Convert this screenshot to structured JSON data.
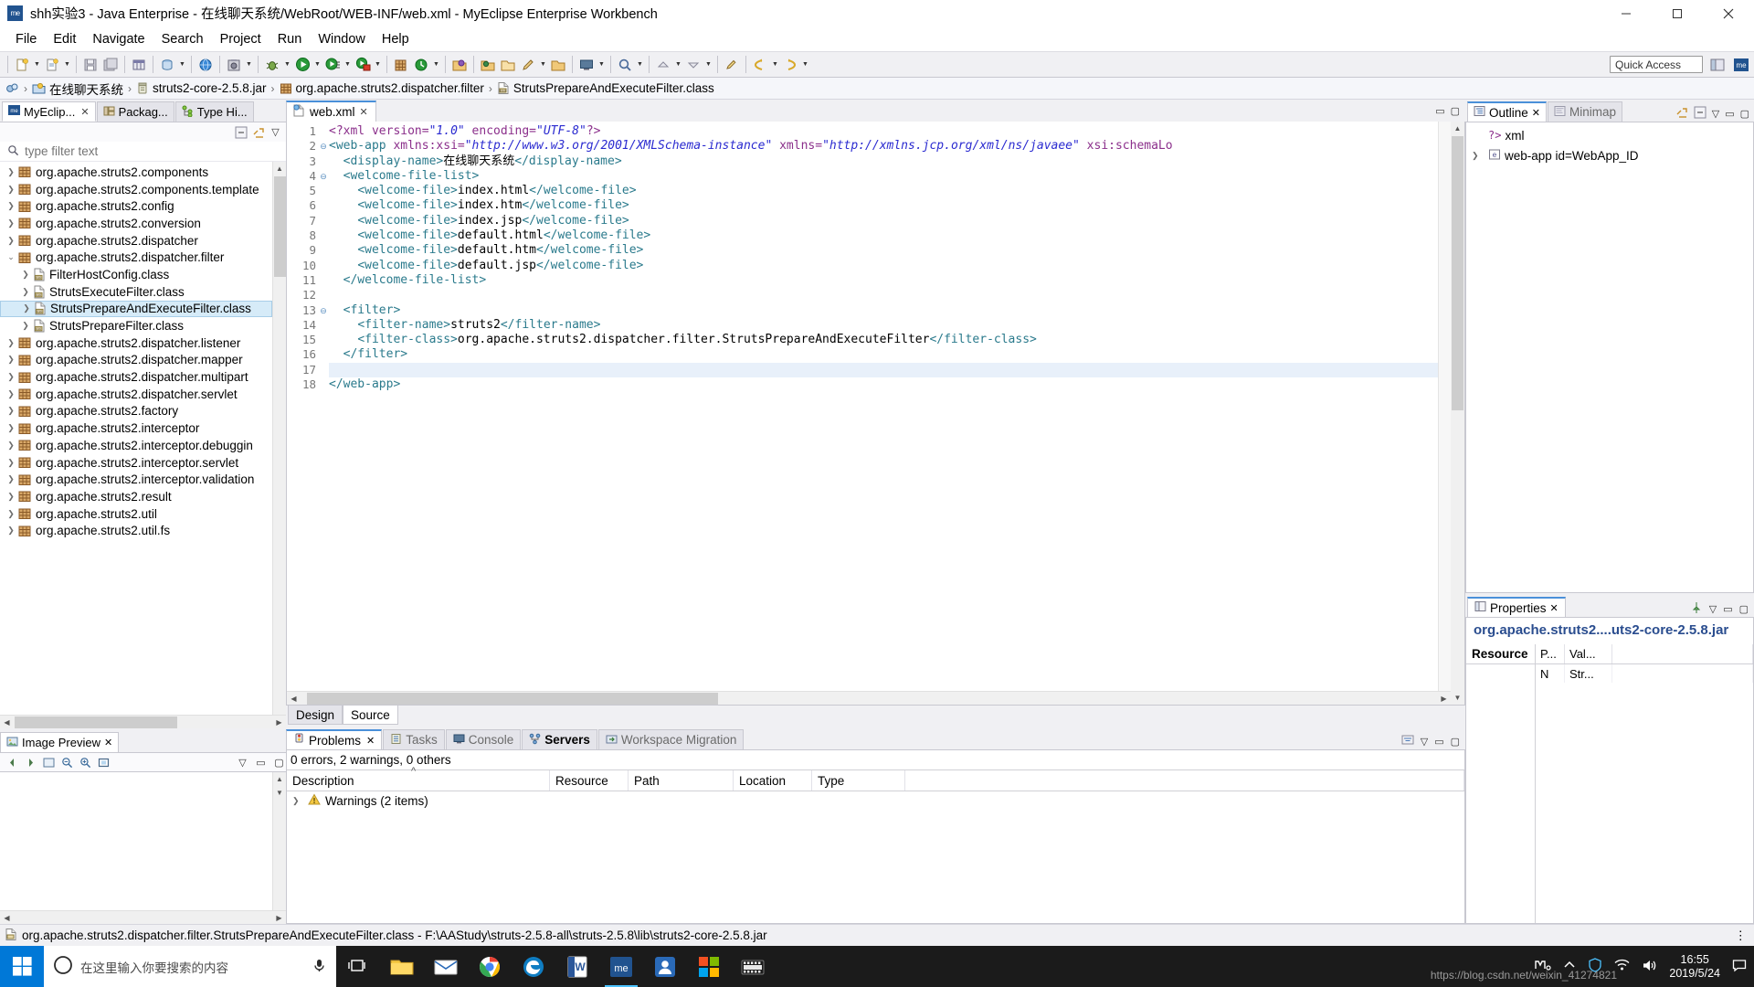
{
  "window": {
    "title": "shh实验3 - Java Enterprise - 在线聊天系统/WebRoot/WEB-INF/web.xml - MyEclipse Enterprise Workbench",
    "app_icon_label": "me",
    "minimize": "minimize-button",
    "maximize": "maximize-button",
    "close": "close-button"
  },
  "menu": {
    "items": [
      "File",
      "Edit",
      "Navigate",
      "Search",
      "Project",
      "Run",
      "Window",
      "Help"
    ]
  },
  "toolbar": {
    "quick_access_placeholder": "Quick Access"
  },
  "breadcrumb": {
    "items": [
      {
        "label": "在线聊天系统",
        "icon": "project-icon"
      },
      {
        "label": "struts2-core-2.5.8.jar",
        "icon": "jar-icon"
      },
      {
        "label": "org.apache.struts2.dispatcher.filter",
        "icon": "package-icon"
      },
      {
        "label": "StrutsPrepareAndExecuteFilter.class",
        "icon": "class-file-icon"
      }
    ]
  },
  "left_panel": {
    "tabs": [
      {
        "label": "MyEclip...",
        "icon": "myeclipse-icon",
        "active": true,
        "closable": true
      },
      {
        "label": "Packag...",
        "icon": "package-explorer-icon",
        "active": false,
        "closable": false
      },
      {
        "label": "Type Hi...",
        "icon": "type-hierarchy-icon",
        "active": false,
        "closable": false
      }
    ],
    "filter_placeholder": "type filter text",
    "tree": [
      {
        "label": "org.apache.struts2.components",
        "type": "package",
        "level": 1,
        "expanded": false
      },
      {
        "label": "org.apache.struts2.components.template",
        "type": "package",
        "level": 1,
        "expanded": false
      },
      {
        "label": "org.apache.struts2.config",
        "type": "package",
        "level": 1,
        "expanded": false
      },
      {
        "label": "org.apache.struts2.conversion",
        "type": "package",
        "level": 1,
        "expanded": false
      },
      {
        "label": "org.apache.struts2.dispatcher",
        "type": "package",
        "level": 1,
        "expanded": false
      },
      {
        "label": "org.apache.struts2.dispatcher.filter",
        "type": "package",
        "level": 1,
        "expanded": true
      },
      {
        "label": "FilterHostConfig.class",
        "type": "class",
        "level": 2,
        "expanded": false
      },
      {
        "label": "StrutsExecuteFilter.class",
        "type": "class",
        "level": 2,
        "expanded": false
      },
      {
        "label": "StrutsPrepareAndExecuteFilter.class",
        "type": "class",
        "level": 2,
        "expanded": false,
        "selected": true
      },
      {
        "label": "StrutsPrepareFilter.class",
        "type": "class",
        "level": 2,
        "expanded": false
      },
      {
        "label": "org.apache.struts2.dispatcher.listener",
        "type": "package",
        "level": 1,
        "expanded": false
      },
      {
        "label": "org.apache.struts2.dispatcher.mapper",
        "type": "package",
        "level": 1,
        "expanded": false
      },
      {
        "label": "org.apache.struts2.dispatcher.multipart",
        "type": "package",
        "level": 1,
        "expanded": false
      },
      {
        "label": "org.apache.struts2.dispatcher.servlet",
        "type": "package",
        "level": 1,
        "expanded": false
      },
      {
        "label": "org.apache.struts2.factory",
        "type": "package",
        "level": 1,
        "expanded": false
      },
      {
        "label": "org.apache.struts2.interceptor",
        "type": "package",
        "level": 1,
        "expanded": false
      },
      {
        "label": "org.apache.struts2.interceptor.debuggin",
        "type": "package",
        "level": 1,
        "expanded": false
      },
      {
        "label": "org.apache.struts2.interceptor.servlet",
        "type": "package",
        "level": 1,
        "expanded": false
      },
      {
        "label": "org.apache.struts2.interceptor.validation",
        "type": "package",
        "level": 1,
        "expanded": false
      },
      {
        "label": "org.apache.struts2.result",
        "type": "package",
        "level": 1,
        "expanded": false
      },
      {
        "label": "org.apache.struts2.util",
        "type": "package",
        "level": 1,
        "expanded": false
      },
      {
        "label": "org.apache.struts2.util.fs",
        "type": "package",
        "level": 1,
        "expanded": false
      }
    ]
  },
  "image_preview": {
    "tab_label": "Image Preview",
    "tab_icon": "image-preview-icon"
  },
  "editor": {
    "tab_label": "web.xml",
    "tab_icon": "xml-file-icon",
    "bottom_tabs": [
      {
        "label": "Design",
        "active": false
      },
      {
        "label": "Source",
        "active": true
      }
    ],
    "cursor_line": 17,
    "lines": [
      {
        "n": 1,
        "fold": "",
        "segs": [
          {
            "t": "pi",
            "v": "<?xml "
          },
          {
            "t": "attr",
            "v": "version="
          },
          {
            "t": "val",
            "v": "\"1.0\""
          },
          {
            "t": "attr",
            "v": " encoding="
          },
          {
            "t": "val",
            "v": "\"UTF-8\""
          },
          {
            "t": "pi",
            "v": "?>"
          }
        ]
      },
      {
        "n": 2,
        "fold": "-",
        "segs": [
          {
            "t": "tag",
            "v": "<web-app "
          },
          {
            "t": "attr",
            "v": "xmlns:xsi="
          },
          {
            "t": "val",
            "v": "\"http://www.w3.org/2001/XMLSchema-instance\""
          },
          {
            "t": "attr",
            "v": " xmlns="
          },
          {
            "t": "val",
            "v": "\"http://xmlns.jcp.org/xml/ns/javaee\""
          },
          {
            "t": "attr",
            "v": " xsi:schemaLo"
          }
        ]
      },
      {
        "n": 3,
        "fold": "",
        "segs": [
          {
            "t": "txt",
            "v": "  "
          },
          {
            "t": "tag",
            "v": "<display-name>"
          },
          {
            "t": "txt",
            "v": "在线聊天系统"
          },
          {
            "t": "tag",
            "v": "</display-name>"
          }
        ]
      },
      {
        "n": 4,
        "fold": "-",
        "segs": [
          {
            "t": "txt",
            "v": "  "
          },
          {
            "t": "tag",
            "v": "<welcome-file-list>"
          }
        ]
      },
      {
        "n": 5,
        "fold": "",
        "segs": [
          {
            "t": "txt",
            "v": "    "
          },
          {
            "t": "tag",
            "v": "<welcome-file>"
          },
          {
            "t": "txt",
            "v": "index.html"
          },
          {
            "t": "tag",
            "v": "</welcome-file>"
          }
        ]
      },
      {
        "n": 6,
        "fold": "",
        "segs": [
          {
            "t": "txt",
            "v": "    "
          },
          {
            "t": "tag",
            "v": "<welcome-file>"
          },
          {
            "t": "txt",
            "v": "index.htm"
          },
          {
            "t": "tag",
            "v": "</welcome-file>"
          }
        ]
      },
      {
        "n": 7,
        "fold": "",
        "segs": [
          {
            "t": "txt",
            "v": "    "
          },
          {
            "t": "tag",
            "v": "<welcome-file>"
          },
          {
            "t": "txt",
            "v": "index.jsp"
          },
          {
            "t": "tag",
            "v": "</welcome-file>"
          }
        ]
      },
      {
        "n": 8,
        "fold": "",
        "segs": [
          {
            "t": "txt",
            "v": "    "
          },
          {
            "t": "tag",
            "v": "<welcome-file>"
          },
          {
            "t": "txt",
            "v": "default.html"
          },
          {
            "t": "tag",
            "v": "</welcome-file>"
          }
        ]
      },
      {
        "n": 9,
        "fold": "",
        "segs": [
          {
            "t": "txt",
            "v": "    "
          },
          {
            "t": "tag",
            "v": "<welcome-file>"
          },
          {
            "t": "txt",
            "v": "default.htm"
          },
          {
            "t": "tag",
            "v": "</welcome-file>"
          }
        ]
      },
      {
        "n": 10,
        "fold": "",
        "segs": [
          {
            "t": "txt",
            "v": "    "
          },
          {
            "t": "tag",
            "v": "<welcome-file>"
          },
          {
            "t": "txt",
            "v": "default.jsp"
          },
          {
            "t": "tag",
            "v": "</welcome-file>"
          }
        ]
      },
      {
        "n": 11,
        "fold": "",
        "segs": [
          {
            "t": "txt",
            "v": "  "
          },
          {
            "t": "tag",
            "v": "</welcome-file-list>"
          }
        ]
      },
      {
        "n": 12,
        "fold": "",
        "segs": [
          {
            "t": "txt",
            "v": ""
          }
        ]
      },
      {
        "n": 13,
        "fold": "-",
        "segs": [
          {
            "t": "txt",
            "v": "  "
          },
          {
            "t": "tag",
            "v": "<filter>"
          }
        ]
      },
      {
        "n": 14,
        "fold": "",
        "segs": [
          {
            "t": "txt",
            "v": "    "
          },
          {
            "t": "tag",
            "v": "<filter-name>"
          },
          {
            "t": "txt",
            "v": "struts2"
          },
          {
            "t": "tag",
            "v": "</filter-name>"
          }
        ]
      },
      {
        "n": 15,
        "fold": "",
        "segs": [
          {
            "t": "txt",
            "v": "    "
          },
          {
            "t": "tag",
            "v": "<filter-class>"
          },
          {
            "t": "txt",
            "v": "org.apache.struts2.dispatcher.filter.StrutsPrepareAndExecuteFilter"
          },
          {
            "t": "tag",
            "v": "</filter-class>"
          }
        ]
      },
      {
        "n": 16,
        "fold": "",
        "segs": [
          {
            "t": "txt",
            "v": "  "
          },
          {
            "t": "tag",
            "v": "</filter>"
          }
        ]
      },
      {
        "n": 17,
        "fold": "",
        "segs": [
          {
            "t": "txt",
            "v": ""
          }
        ]
      },
      {
        "n": 18,
        "fold": "",
        "segs": [
          {
            "t": "tag",
            "v": "</web-app>"
          }
        ]
      }
    ]
  },
  "problems": {
    "tabs": [
      {
        "label": "Problems",
        "icon": "problems-icon",
        "active": true,
        "closable": true,
        "bold": false
      },
      {
        "label": "Tasks",
        "icon": "tasks-icon",
        "active": false,
        "closable": false,
        "bold": false
      },
      {
        "label": "Console",
        "icon": "console-icon",
        "active": false,
        "closable": false,
        "bold": false
      },
      {
        "label": "Servers",
        "icon": "servers-icon",
        "active": false,
        "closable": false,
        "bold": true
      },
      {
        "label": "Workspace Migration",
        "icon": "migration-icon",
        "active": false,
        "closable": false,
        "bold": false
      }
    ],
    "summary": "0 errors, 2 warnings, 0 others",
    "columns": [
      "Description",
      "Resource",
      "Path",
      "Location",
      "Type"
    ],
    "rows": [
      {
        "description": "Warnings (2 items)",
        "resource": "",
        "path": "",
        "location": "",
        "type": "",
        "icon": "warning-icon"
      }
    ]
  },
  "outline": {
    "tabs": [
      {
        "label": "Outline",
        "icon": "outline-icon",
        "active": true,
        "closable": true
      },
      {
        "label": "Minimap",
        "icon": "minimap-icon",
        "active": false,
        "closable": false
      }
    ],
    "rows": [
      {
        "label": "xml",
        "icon": "pi-icon",
        "level": 1,
        "expandable": false
      },
      {
        "label": "web-app id=WebApp_ID",
        "icon": "element-icon",
        "level": 1,
        "expandable": true
      }
    ]
  },
  "properties": {
    "tab_label": "Properties",
    "tab_icon": "properties-icon",
    "title": "org.apache.struts2....uts2-core-2.5.8.jar",
    "left_header": "Resource",
    "columns": [
      "P...",
      "Val..."
    ],
    "rows": [
      {
        "prop": "N",
        "value": "Str..."
      }
    ]
  },
  "statusbar": {
    "icon": "class-file-icon",
    "text": "org.apache.struts2.dispatcher.filter.StrutsPrepareAndExecuteFilter.class - F:\\AAStudy\\struts-2.5.8-all\\struts-2.5.8\\lib\\struts2-core-2.5.8.jar"
  },
  "taskbar": {
    "search_placeholder": "在这里输入你要搜索的内容",
    "search_icon": "cortana-circle-icon",
    "mic_icon": "microphone-icon",
    "items": [
      {
        "name": "task-view-icon",
        "active": false
      },
      {
        "name": "file-explorer-icon",
        "active": false
      },
      {
        "name": "mail-icon",
        "active": false
      },
      {
        "name": "chrome-icon",
        "active": false
      },
      {
        "name": "edge-icon",
        "active": false
      },
      {
        "name": "word-icon",
        "active": false
      },
      {
        "name": "myeclipse-icon",
        "active": true
      },
      {
        "name": "people-icon",
        "active": false
      },
      {
        "name": "store-icon",
        "active": false
      },
      {
        "name": "video-icon",
        "active": false
      }
    ],
    "tray": [
      "input-method-icon",
      "chevron-up-icon",
      "shield-icon",
      "network-icon",
      "volume-icon",
      "ime-icon"
    ],
    "clock_time": "16:55",
    "clock_date": "2019/5/24",
    "watermark": "https://blog.csdn.net/weixin_41274821"
  },
  "colors": {
    "accent": "#4a90d9",
    "selection": "#d6ebf8",
    "tag": "#2a7a8c",
    "attr": "#8b2f8b",
    "value": "#2a2ad0",
    "link": "#2a4d8f"
  }
}
